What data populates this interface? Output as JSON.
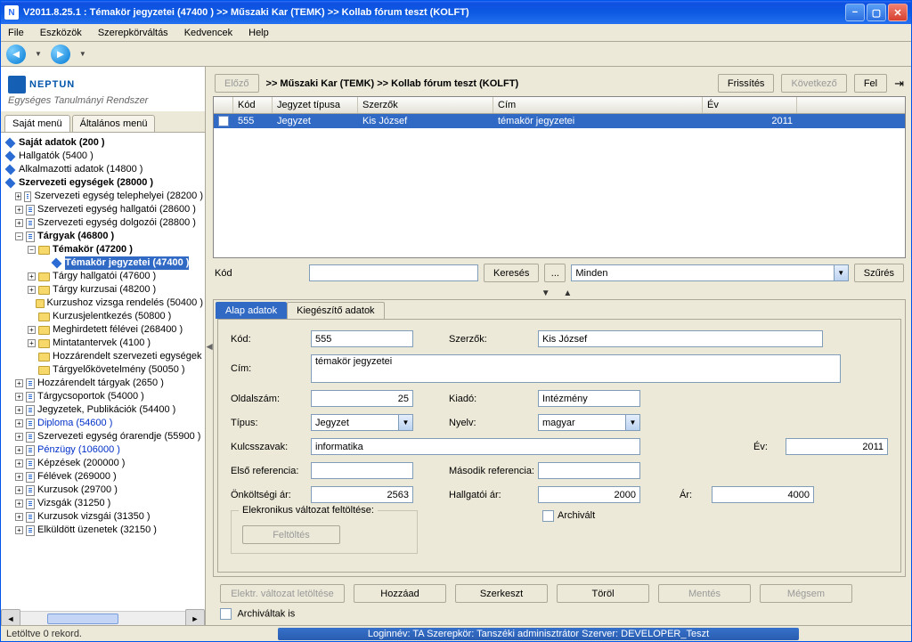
{
  "window": {
    "title": "V2011.8.25.1 : Témakör jegyzetei (47400  )   >> Műszaki Kar (TEMK) >> Kollab fórum teszt (KOLFT)"
  },
  "menu": {
    "file": "File",
    "eszkozok": "Eszközök",
    "szerep": "Szerepkörváltás",
    "kedvencek": "Kedvencek",
    "help": "Help"
  },
  "logo": {
    "title": "NEPTUN",
    "subtitle": "Egységes Tanulmányi Rendszer"
  },
  "sidebar_tabs": {
    "sajat": "Saját menü",
    "altalanos": "Általános menü"
  },
  "tree": {
    "sajat_adatok": "Saját adatok (200  )",
    "hallgatok": "Hallgatók (5400  )",
    "alk": "Alkalmazotti adatok (14800  )",
    "szerv": "Szervezeti egységek (28000  )",
    "szerv_tel": "Szervezeti egység telephelyei (28200  )",
    "szerv_hall": "Szervezeti egység hallgatói (28600  )",
    "szerv_dolg": "Szervezeti egység dolgozói (28800  )",
    "targyak": "Tárgyak (46800  )",
    "temakor": "Témakör (47200  )",
    "temakor_jegy": "Témakör jegyzetei (47400  )",
    "targyhall": "Tárgy hallgatói (47600  )",
    "targykurz": "Tárgy kurzusai (48200  )",
    "kurzvizsga": "Kurzushoz vizsga rendelés (50400  )",
    "kurzusjel": "Kurzusjelentkezés (50800  )",
    "meghird": "Meghirdetett félévei (268400  )",
    "mintatant": "Mintatantervek (4100  )",
    "hozzarsze": "Hozzárendelt szervezeti egységek",
    "targyelo": "Tárgyelőkövetelmény (50050  )",
    "hozzartarg": "Hozzárendelt tárgyak (2650  )",
    "targycsop": "Tárgycsoportok (54000  )",
    "jegyzetek": "Jegyzetek, Publikációk (54400  )",
    "diploma": "Diploma (54600  )",
    "szervegyord": "Szervezeti egység órarendje (55900  )",
    "penzugy": "Pénzügy (106000  )",
    "kepzesek": "Képzések (200000  )",
    "felevek": "Félévek (269000  )",
    "kurzusok": "Kurzusok (29700  )",
    "vizsgak": "Vizsgák (31250  )",
    "kurzvizsg": "Kurzusok vizsgái (31350  )",
    "elkuldott": "Elküldött üzenetek (32150  )"
  },
  "topbar": {
    "elozo": "Előző",
    "breadcrumb": ">> Műszaki Kar (TEMK) >> Kollab fórum teszt (KOLFT)",
    "frissites": "Frissítés",
    "kovetkezo": "Következő",
    "fel": "Fel"
  },
  "grid": {
    "headers": {
      "kod": "Kód",
      "tipus": "Jegyzet típusa",
      "szerzok": "Szerzők",
      "cim": "Cím",
      "ev": "Év"
    },
    "row": {
      "kod": "555",
      "tipus": "Jegyzet",
      "szerzok": "Kis József",
      "cim": "témakör jegyzetei",
      "ev": "2011"
    }
  },
  "search": {
    "label": "Kód",
    "kereses": "Keresés",
    "more": "...",
    "minden": "Minden",
    "szures": "Szűrés"
  },
  "detail_tabs": {
    "alap": "Alap adatok",
    "kieg": "Kiegészítő adatok"
  },
  "form": {
    "kod_l": "Kód:",
    "kod_v": "555",
    "szerzok_l": "Szerzők:",
    "szerzok_v": "Kis József",
    "cim_l": "Cím:",
    "cim_v": "témakör jegyzetei",
    "oldal_l": "Oldalszám:",
    "oldal_v": "25",
    "kiado_l": "Kiadó:",
    "kiado_v": "Intézmény",
    "tipus_l": "Típus:",
    "tipus_v": "Jegyzet",
    "nyelv_l": "Nyelv:",
    "nyelv_v": "magyar",
    "kulcs_l": "Kulcsszavak:",
    "kulcs_v": "informatika",
    "ev_l": "Év:",
    "ev_v": "2011",
    "ref1_l": "Első referencia:",
    "ref2_l": "Második referencia:",
    "onkolt_l": "Önköltségi ár:",
    "onkolt_v": "2563",
    "hallar_l": "Hallgatói ár:",
    "hallar_v": "2000",
    "ar_l": "Ár:",
    "ar_v": "4000",
    "elek_legend": "Elekronikus változat feltöltése:",
    "feltoltes": "Feltöltés",
    "archivalt": "Archivált"
  },
  "actions": {
    "letolt": "Elektr. változat letöltése",
    "hozzaad": "Hozzáad",
    "szerkeszt": "Szerkeszt",
    "torol": "Töröl",
    "mentes": "Mentés",
    "megsem": "Mégsem",
    "archivaltak": "Archiváltak is"
  },
  "status": {
    "left": "Letöltve 0 rekord.",
    "mid": "Loginnév: TA   Szerepkör: Tanszéki adminisztrátor   Szerver: DEVELOPER_Teszt"
  }
}
